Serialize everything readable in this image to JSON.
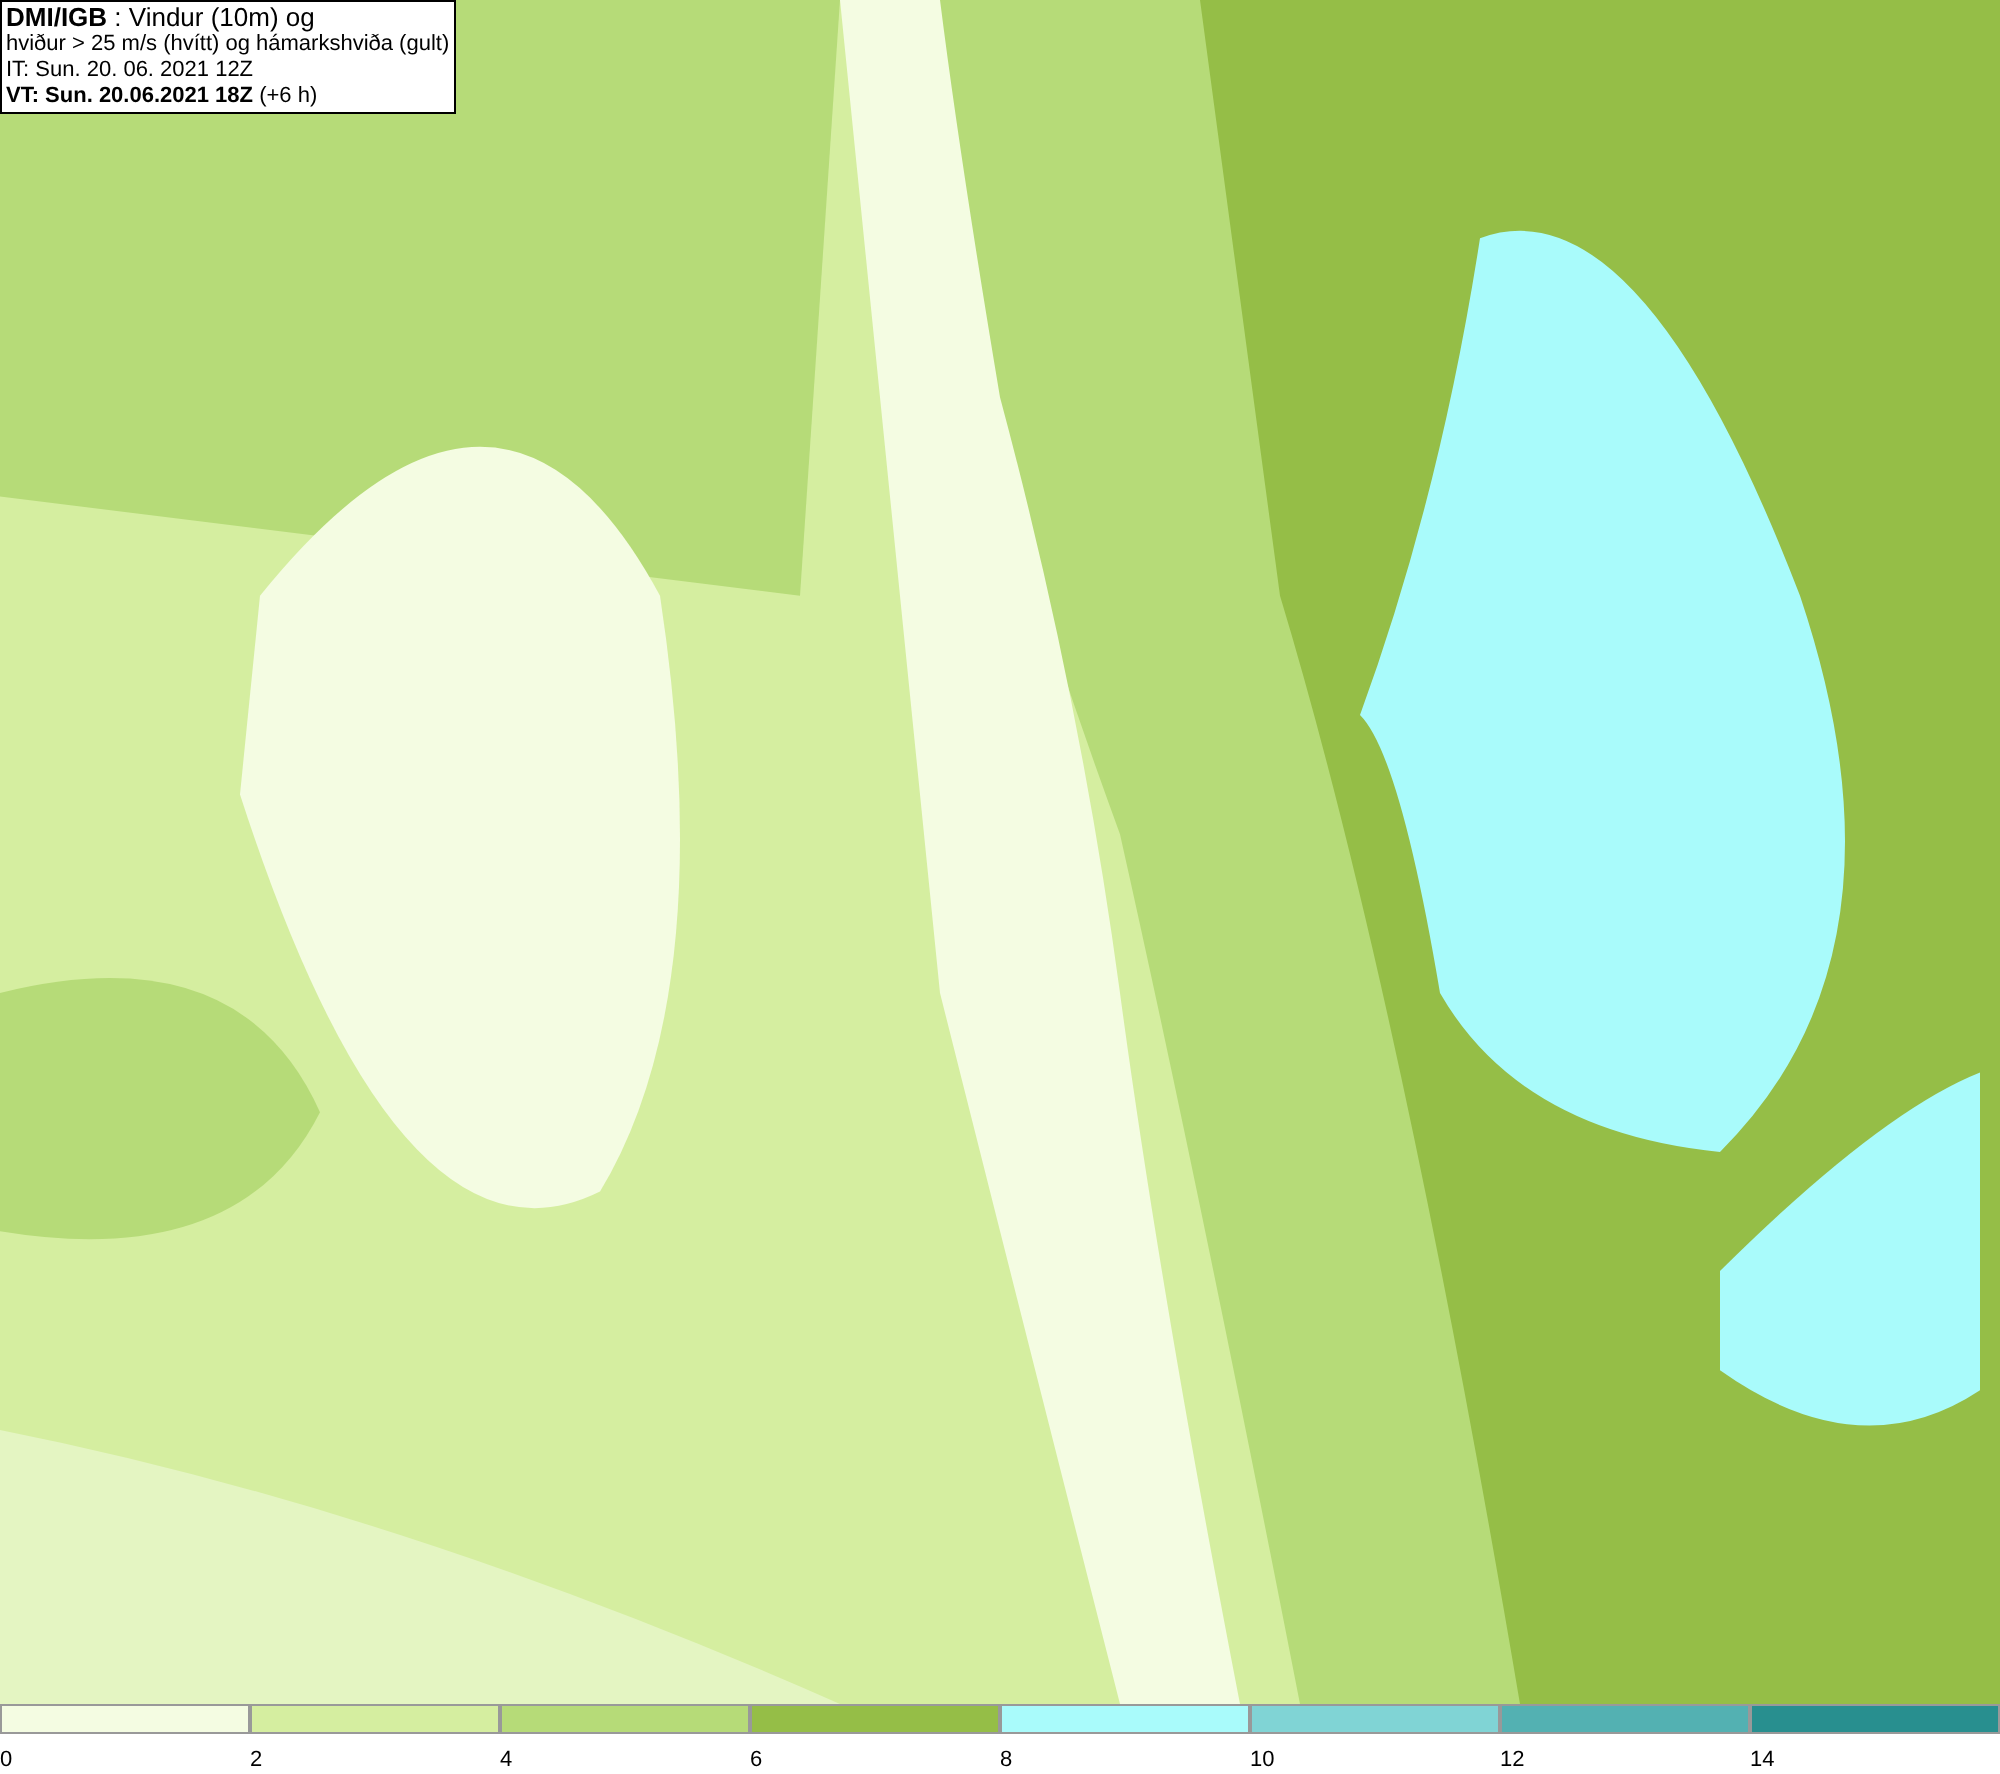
{
  "title_box": {
    "lines": [
      "**DMI/IGB** : Vindur (10m) og",
      "hviður > 25 m/s (hvítt) og hámarkshviða (gult)",
      "IT: Sun. 20. 06. 2021 12Z",
      "**VT: Sun. 20.06.2021 18Z** (+6 h)"
    ]
  },
  "legend": {
    "bins": [
      {
        "label": "0",
        "color": "#f4fce2"
      },
      {
        "label": "2",
        "color": "#d5eea0"
      },
      {
        "label": "4",
        "color": "#b6db78"
      },
      {
        "label": "6",
        "color": "#95be47"
      },
      {
        "label": "8",
        "color": "#a9fbfb"
      },
      {
        "label": "10",
        "color": "#80d4d5"
      },
      {
        "label": "12",
        "color": "#53b1b2"
      },
      {
        "label": "14",
        "color": "#288f8f"
      }
    ]
  }
}
